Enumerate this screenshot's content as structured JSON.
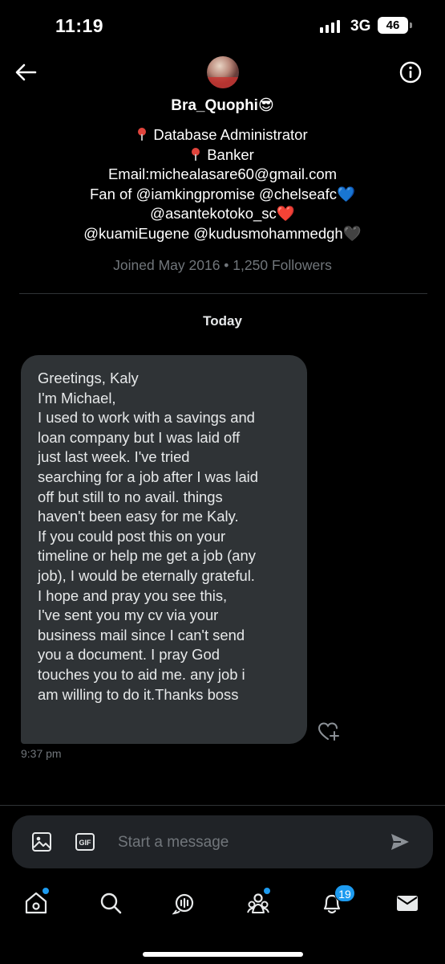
{
  "status_bar": {
    "time": "11:19",
    "network": "3G",
    "battery": "46"
  },
  "header": {
    "profile_name": "Bra_Quophi😎",
    "back_icon": "arrow-left-icon",
    "info_icon": "info-circle-icon"
  },
  "bio": {
    "line1": "Database Administrator",
    "line2": "Banker",
    "line3": "Email:michealasare60@gmail.com",
    "line4": "Fan of @iamkingpromise @chelseafc💙",
    "line5": "@asantekotoko_sc❤️",
    "line6": "@kuamiEugene @kudusmohammedgh🖤",
    "joined": "Joined May 2016 • 1,250 Followers"
  },
  "conversation": {
    "date_separator": "Today",
    "message": {
      "lines": [
        "Greetings, Kaly",
        "I'm Michael,",
        "I used to work with a savings and",
        "loan company but I was laid off",
        "just last week. I've tried",
        "searching for a job after I was laid",
        "off but still to no avail. things",
        "haven't been easy for me Kaly.",
        "If you could post this on your",
        "timeline or help me get a job (any",
        "job), I would be eternally grateful.",
        "I hope and pray you see this,",
        "I've sent you my cv via your",
        "business mail since I can't send",
        "you a document. I pray God",
        "touches you to aid me. any job i",
        "am willing to do it.Thanks boss"
      ],
      "time": "9:37 pm"
    }
  },
  "composer": {
    "placeholder": "Start a message",
    "gif_label": "GIF"
  },
  "bottom_nav": {
    "items": [
      "home",
      "search",
      "spaces",
      "communities",
      "notifications",
      "messages"
    ],
    "notifications_badge": "19"
  },
  "colors": {
    "accent": "#1d9bf0",
    "bubble": "#2f3336",
    "muted": "#71767b"
  }
}
